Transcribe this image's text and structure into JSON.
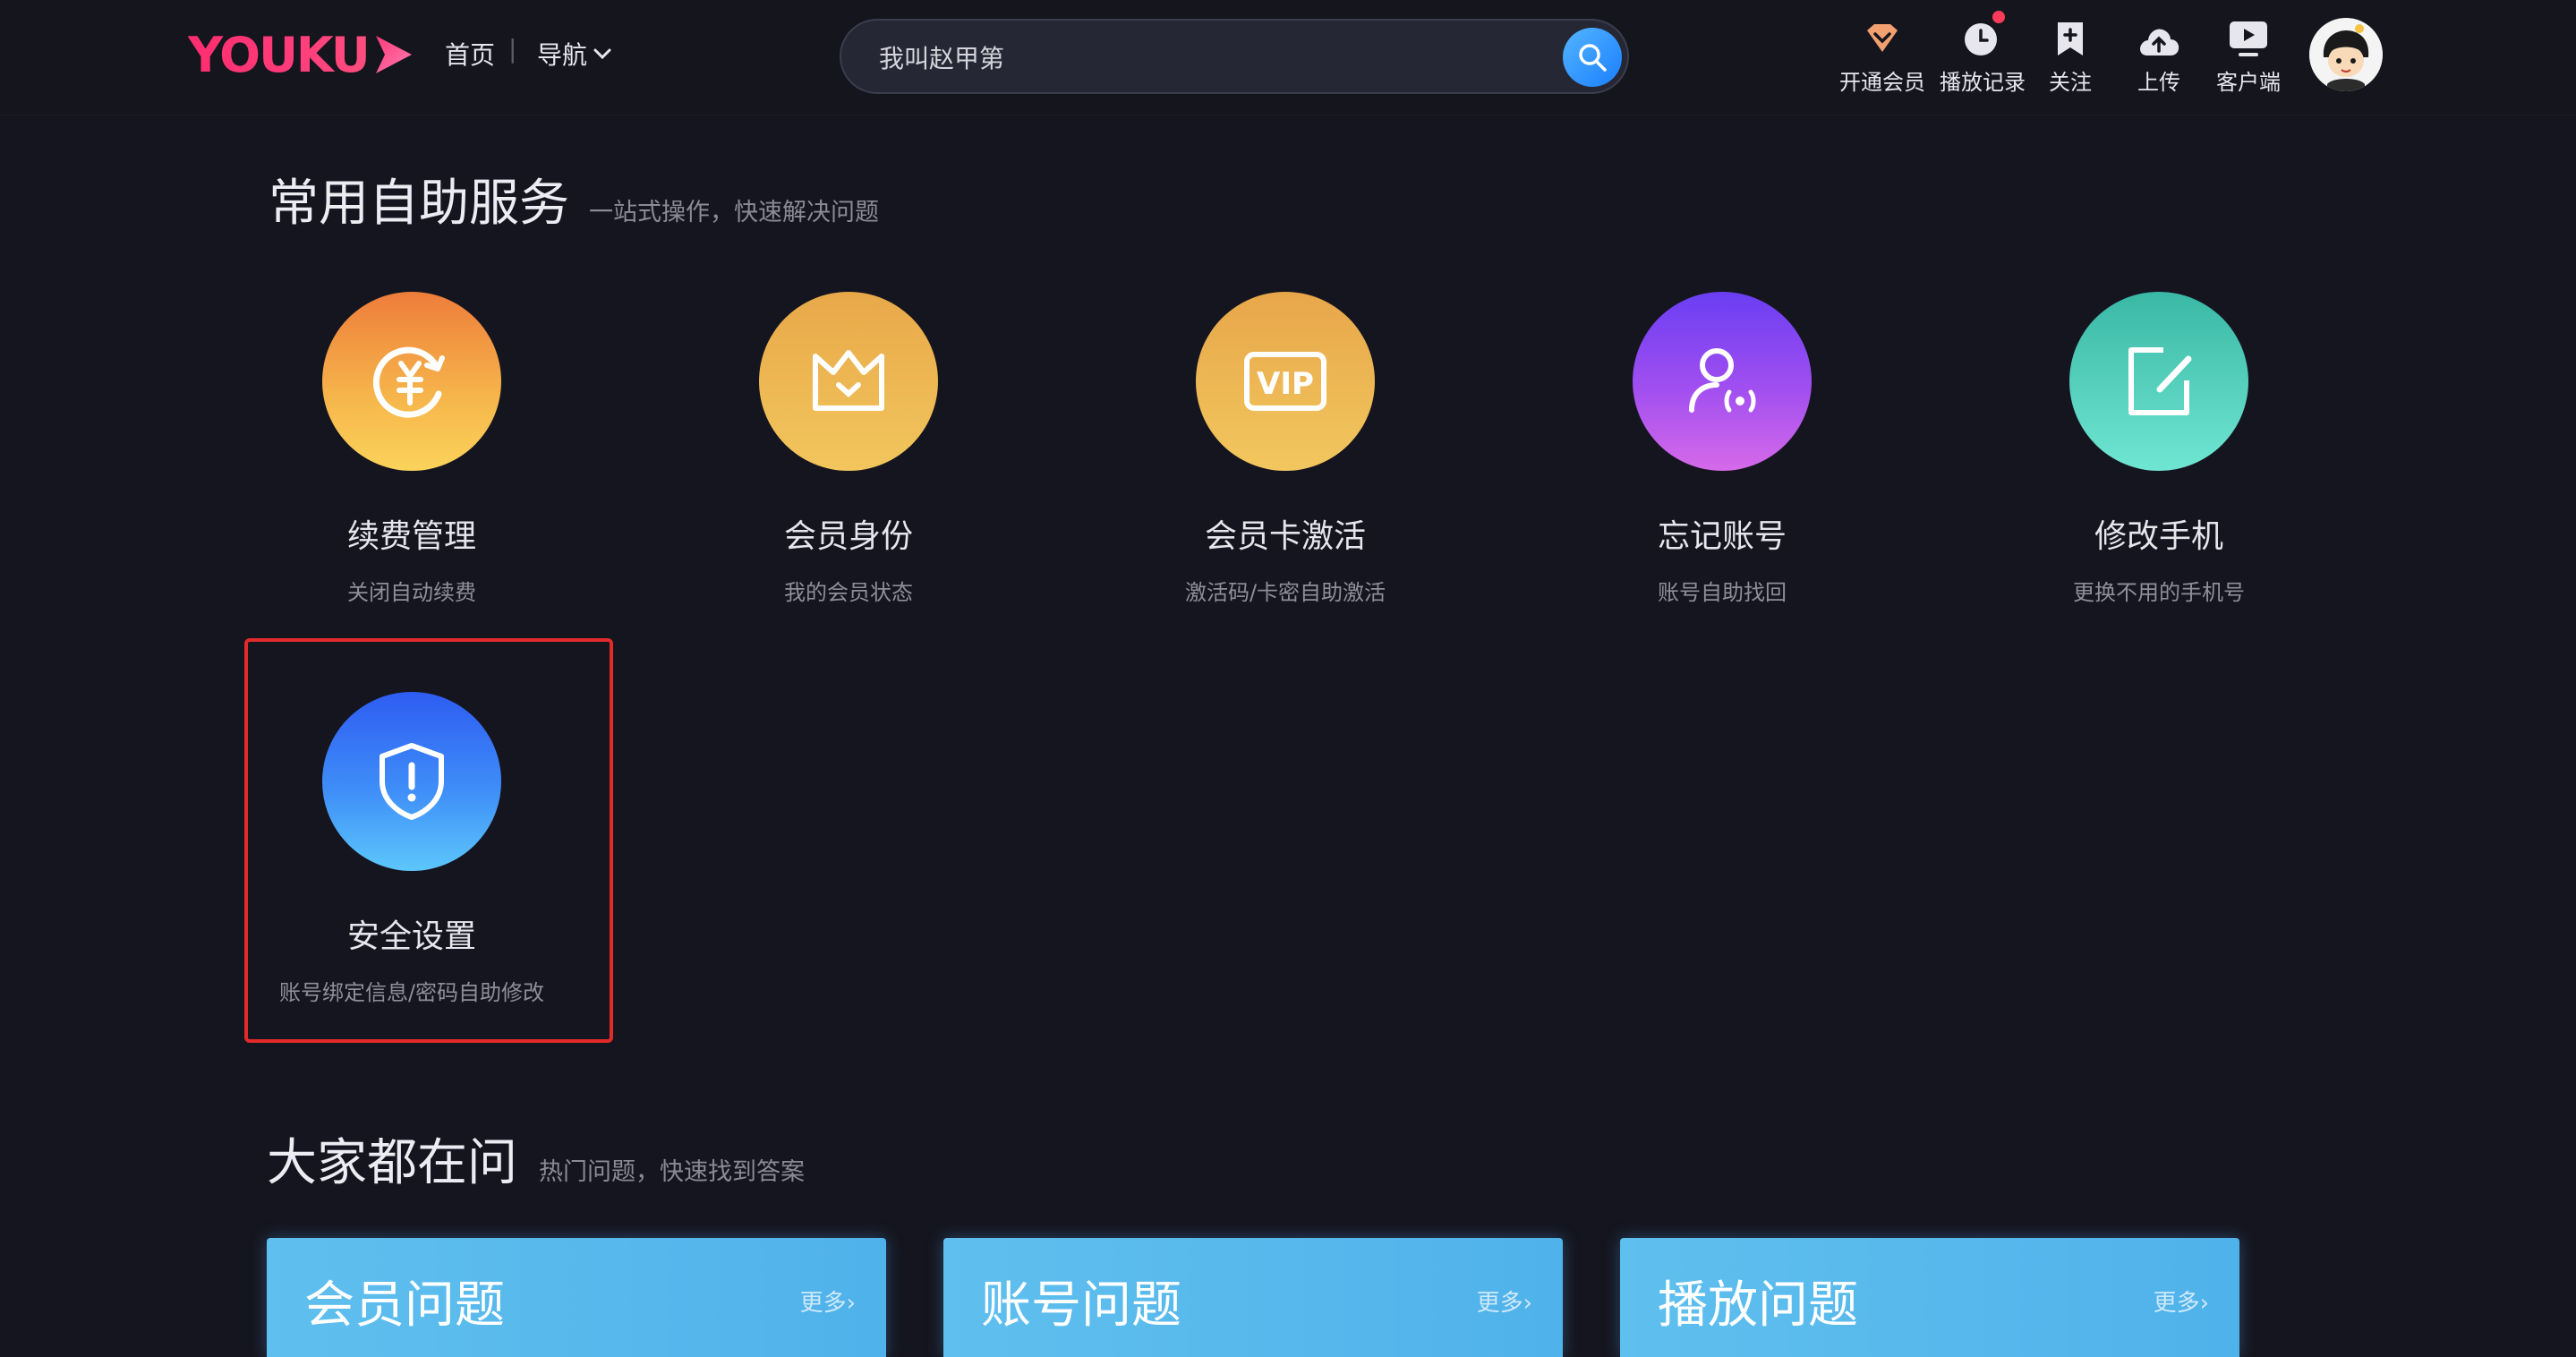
{
  "header": {
    "logo_text": "YOUKU",
    "nav_home": "首页",
    "nav_separator": "|",
    "nav_guide": "导航",
    "search_value": "我叫赵甲第",
    "items": [
      {
        "label": "开通会员",
        "icon": "vip-diamond-icon"
      },
      {
        "label": "播放记录",
        "icon": "clock-icon"
      },
      {
        "label": "关注",
        "icon": "bookmark-plus-icon"
      },
      {
        "label": "上传",
        "icon": "cloud-upload-icon"
      },
      {
        "label": "客户端",
        "icon": "monitor-play-icon"
      }
    ]
  },
  "self_service": {
    "title": "常用自助服务",
    "subtitle": "一站式操作，快速解决问题",
    "items": [
      {
        "name": "续费管理",
        "desc": "关闭自动续费",
        "icon": "yuan-renew-icon"
      },
      {
        "name": "会员身份",
        "desc": "我的会员状态",
        "icon": "crown-icon"
      },
      {
        "name": "会员卡激活",
        "desc": "激活码/卡密自助激活",
        "icon": "vip-card-icon"
      },
      {
        "name": "忘记账号",
        "desc": "账号自助找回",
        "icon": "user-search-icon"
      },
      {
        "name": "修改手机",
        "desc": "更换不用的手机号",
        "icon": "edit-icon"
      },
      {
        "name": "安全设置",
        "desc": "账号绑定信息/密码自助修改",
        "icon": "shield-icon"
      }
    ]
  },
  "faq": {
    "title": "大家都在问",
    "subtitle": "热门问题，快速找到答案",
    "cards": [
      {
        "title": "会员问题",
        "more": "更多›"
      },
      {
        "title": "账号问题",
        "more": "更多›"
      },
      {
        "title": "播放问题",
        "more": "更多›"
      }
    ]
  },
  "colors": {
    "background": "#15151f",
    "brand": "#ff3b7a",
    "highlight_border": "#e22a2a",
    "card": "#5fbfee"
  }
}
